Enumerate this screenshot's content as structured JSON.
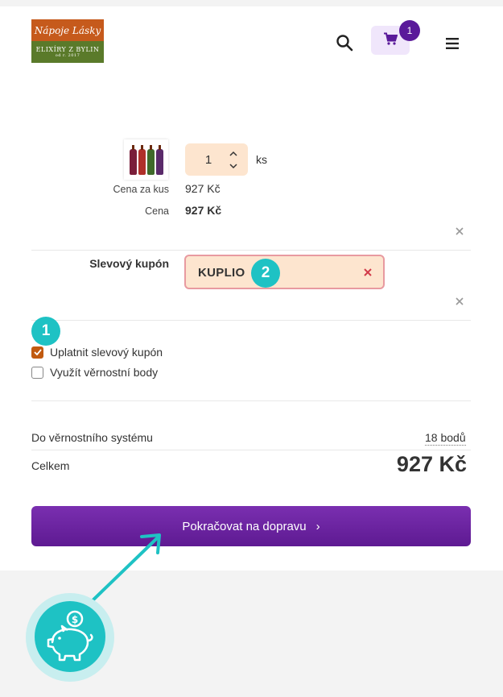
{
  "header": {
    "logo_top": "Nápoje Lásky",
    "logo_bottom": "ELIXÍRY Z BYLIN",
    "logo_small": "od r. 2017",
    "cart_count": "1"
  },
  "product": {
    "quantity": "1",
    "unit": "ks",
    "unit_price_label": "Cena za kus",
    "unit_price": "927 Kč",
    "price_label": "Cena",
    "price": "927 Kč",
    "bottle_colors": [
      "#7a1e3a",
      "#b0302a",
      "#3f6a2a",
      "#5a2a6a"
    ]
  },
  "coupon": {
    "label": "Slevový kupón",
    "value": "KUPLIO",
    "step_badge": "2"
  },
  "options": {
    "step_badge": "1",
    "apply_coupon": {
      "label": "Uplatnit slevový kupón",
      "checked": true
    },
    "use_points": {
      "label": "Využít věrnostní body",
      "checked": false
    }
  },
  "summary": {
    "loyalty_label": "Do věrnostního systému",
    "loyalty_points": "18 bodů",
    "total_label": "Celkem",
    "total_value": "927 Kč"
  },
  "cta": {
    "label": "Pokračovat na dopravu",
    "chevron": "›"
  },
  "colors": {
    "accent": "#6a2aa0",
    "teal": "#1ec2c4",
    "field_bg": "#fde5cf",
    "checkbox": "#c15a10"
  }
}
